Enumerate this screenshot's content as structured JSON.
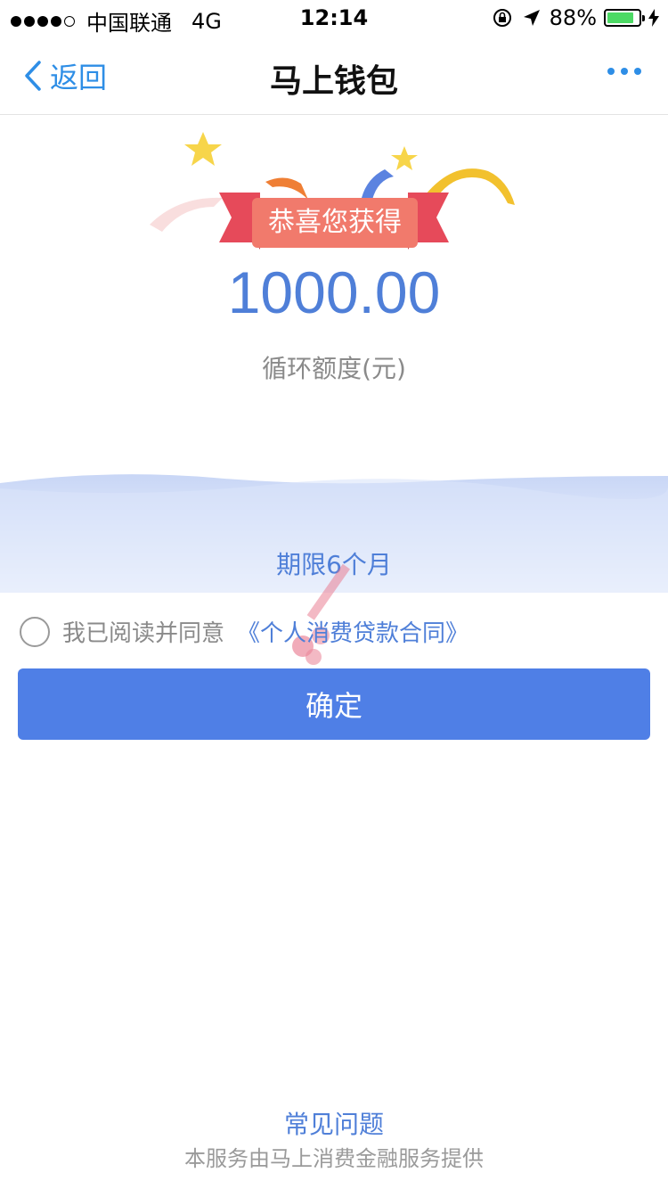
{
  "status_bar": {
    "carrier": "中国联通",
    "network": "4G",
    "time": "12:14",
    "battery_percent": "88%",
    "battery_level": 0.88,
    "signal_bars_filled": 4,
    "signal_bars_total": 5,
    "battery_color": "#4cd964"
  },
  "nav": {
    "back_label": "返回",
    "title": "马上钱包",
    "more_icon": "more-dots-icon",
    "accent_color": "#2e8ee6"
  },
  "banner": {
    "ribbon_text": "恭喜您获得",
    "amount": "1000.00",
    "amount_label": "循环额度(元)",
    "term": "期限6个月"
  },
  "agreement": {
    "text": "我已阅读并同意",
    "contract_link": "《个人消费贷款合同》",
    "checked": false
  },
  "confirm_button": {
    "label": "确定",
    "color": "#4f7fe6"
  },
  "footer": {
    "faq_label": "常见问题",
    "provider_text": "本服务由马上消费金融服务提供"
  }
}
